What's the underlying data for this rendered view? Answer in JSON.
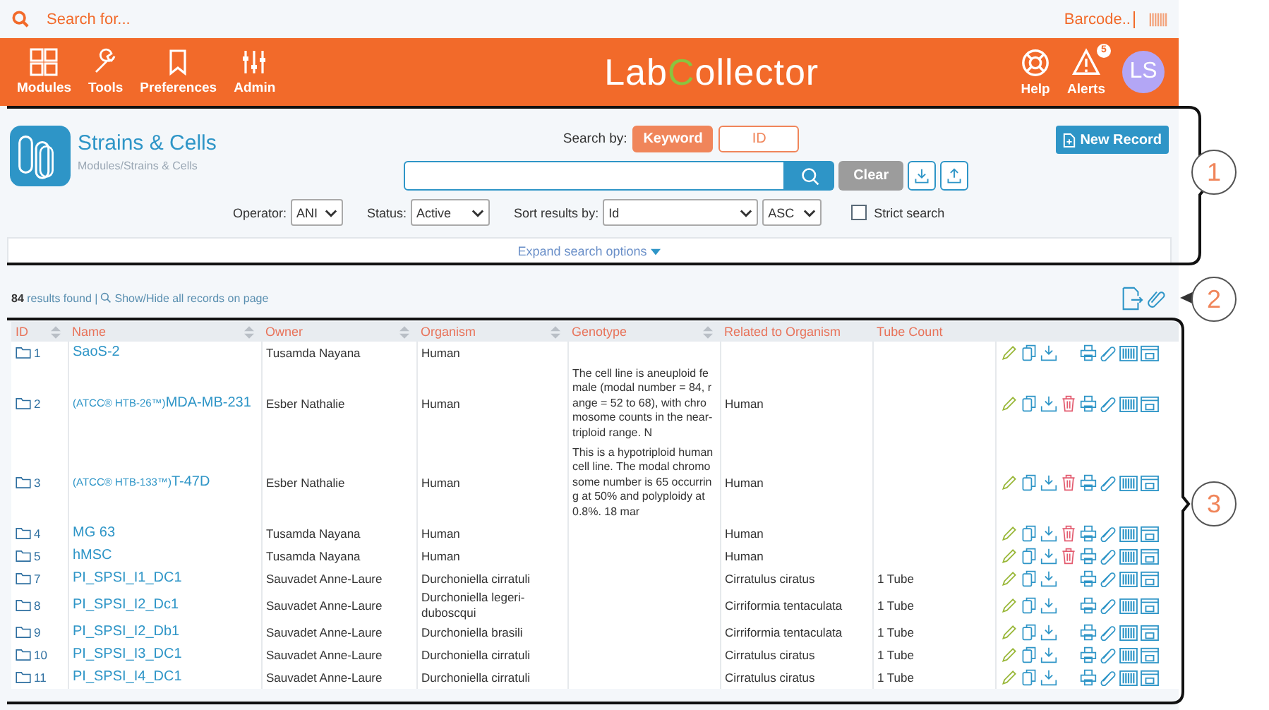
{
  "top_search": {
    "placeholder": "Search for...",
    "barcode_placeholder": "Barcode.."
  },
  "nav": {
    "left": [
      {
        "label": "Modules"
      },
      {
        "label": "Tools"
      },
      {
        "label": "Preferences"
      },
      {
        "label": "Admin"
      }
    ],
    "logo": [
      "Lab",
      "C",
      "ollector"
    ],
    "right": [
      {
        "label": "Help"
      },
      {
        "label": "Alerts",
        "badge": "5"
      }
    ],
    "avatar": "LS"
  },
  "module": {
    "title": "Strains & Cells",
    "breadcrumb": "Modules/Strains & Cells"
  },
  "search": {
    "label": "Search by:",
    "options": [
      {
        "label": "Keyword",
        "selected": true
      },
      {
        "label": "ID",
        "selected": false
      }
    ],
    "clear": "Clear",
    "new_record": "New Record",
    "filters": [
      {
        "label": "Operator:",
        "value": "ANI",
        "kind": "narrow"
      },
      {
        "label": "Status:",
        "value": "Active",
        "kind": "medium"
      },
      {
        "label": "Sort results by:",
        "value": "Id",
        "kind": "wide"
      }
    ],
    "order": "ASC",
    "strict": {
      "label": "Strict search",
      "checked": false
    },
    "expand": "Expand search options"
  },
  "results": {
    "count": "84",
    "text": "results found |",
    "toggle": "Show/Hide all records on page"
  },
  "table": {
    "columns": [
      {
        "label": "ID",
        "sortable": true
      },
      {
        "label": "Name",
        "sortable": true
      },
      {
        "label": "Owner",
        "sortable": true
      },
      {
        "label": "Organism",
        "sortable": true
      },
      {
        "label": "Genotype",
        "sortable": true
      },
      {
        "label": "Related to Organism",
        "sortable": false
      },
      {
        "label": "Tube Count",
        "sortable": false
      }
    ],
    "rows": [
      {
        "id": "1",
        "name": "SaoS-2",
        "owner": "Tusamda Nayana",
        "organism": "Human",
        "genotype": "",
        "related": "",
        "tubes": "",
        "deletable": false
      },
      {
        "id": "2",
        "prefix": "(ATCC® HTB-26™)",
        "name": "MDA-MB-231",
        "owner": "Esber Nathalie",
        "organism": "Human",
        "genotype": "The cell line is aneuploid female (modal number = 84, range = 52 to 68), with chromosome counts in the near-triploid range. N",
        "related": "Human",
        "tubes": "",
        "deletable": true
      },
      {
        "id": "3",
        "prefix": "(ATCC® HTB-133™)",
        "name": "T-47D",
        "owner": "Esber Nathalie",
        "organism": "Human",
        "genotype": "This is a hypotriploid human cell line. The modal chromosome number is 65 occurring at 50% and polyploidy at 0.8%. 18 mar",
        "related": "Human",
        "tubes": "",
        "deletable": true
      },
      {
        "id": "4",
        "name": "MG 63",
        "owner": "Tusamda Nayana",
        "organism": "Human",
        "genotype": "",
        "related": "Human",
        "tubes": "",
        "deletable": true
      },
      {
        "id": "5",
        "name": "hMSC",
        "owner": "Tusamda Nayana",
        "organism": "Human",
        "genotype": "",
        "related": "Human",
        "tubes": "",
        "deletable": true
      },
      {
        "id": "7",
        "name": "PI_SPSI_I1_DC1",
        "owner": "Sauvadet Anne-Laure",
        "organism": "Durchoniella cirratuli",
        "genotype": "",
        "related": "Cirratulus ciratus",
        "tubes": "1 Tube",
        "deletable": false
      },
      {
        "id": "8",
        "name": "PI_SPSI_I2_Dc1",
        "owner": "Sauvadet Anne-Laure",
        "organism": "Durchoniella legeri-duboscqui",
        "genotype": "",
        "related": "Cirriformia tentaculata",
        "tubes": "1 Tube",
        "deletable": false
      },
      {
        "id": "9",
        "name": "PI_SPSI_I2_Db1",
        "owner": "Sauvadet Anne-Laure",
        "organism": "Durchoniella brasili",
        "genotype": "",
        "related": "Cirriformia tentaculata",
        "tubes": "1 Tube",
        "deletable": false
      },
      {
        "id": "10",
        "name": "PI_SPSI_I3_DC1",
        "owner": "Sauvadet Anne-Laure",
        "organism": "Durchoniella cirratuli",
        "genotype": "",
        "related": "Cirratulus ciratus",
        "tubes": "1 Tube",
        "deletable": false
      },
      {
        "id": "11",
        "name": "PI_SPSI_I4_DC1",
        "owner": "Sauvadet Anne-Laure",
        "organism": "Durchoniella cirratuli",
        "genotype": "",
        "related": "Cirratulus ciratus",
        "tubes": "1 Tube",
        "deletable": false
      }
    ]
  },
  "callouts": [
    {
      "label": "1"
    },
    {
      "label": "2"
    },
    {
      "label": "3"
    }
  ]
}
